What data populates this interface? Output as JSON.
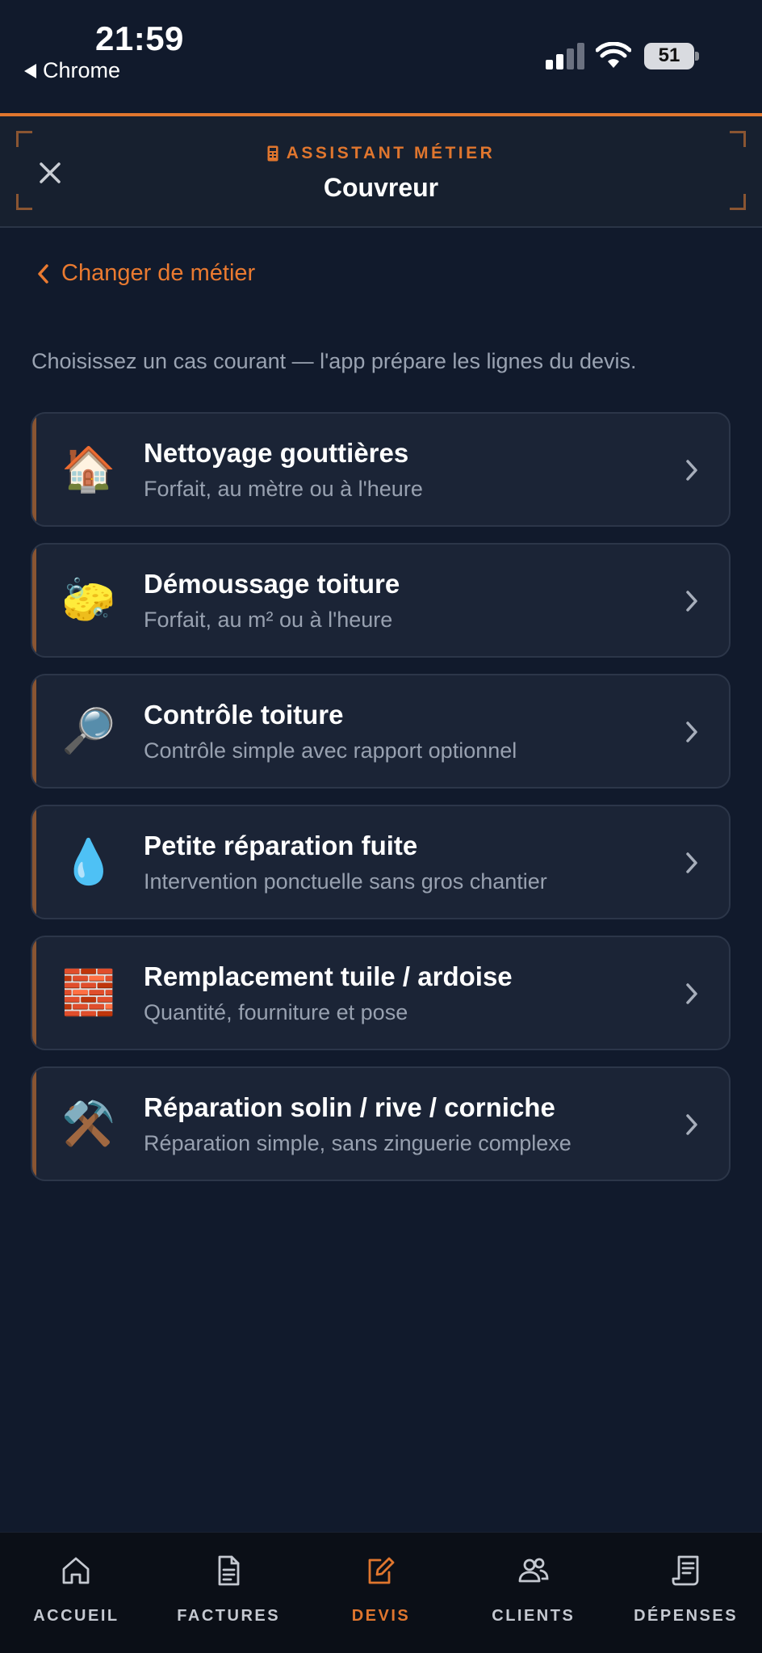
{
  "status_bar": {
    "time": "21:59",
    "back_app": "Chrome",
    "battery": "51",
    "icons": [
      "cellular-signal-icon",
      "wifi-icon",
      "battery-icon"
    ]
  },
  "header": {
    "kicker_icon": "calculator-icon",
    "kicker": "ASSISTANT MÉTIER",
    "title": "Couvreur",
    "close_icon": "close-icon"
  },
  "back_link": {
    "label": "Changer de métier",
    "icon": "chevron-left-icon"
  },
  "intro": "Choisissez un cas courant — l'app prépare les lignes du devis.",
  "cases": [
    {
      "icon": "🏠",
      "icon_name": "house-icon",
      "title": "Nettoyage gouttières",
      "subtitle": "Forfait, au mètre ou à l'heure"
    },
    {
      "icon": "🧽",
      "icon_name": "sponge-icon",
      "title": "Démoussage toiture",
      "subtitle": "Forfait, au m² ou à l'heure"
    },
    {
      "icon": "🔎",
      "icon_name": "magnifier-icon",
      "title": "Contrôle toiture",
      "subtitle": "Contrôle simple avec rapport optionnel"
    },
    {
      "icon": "💧",
      "icon_name": "droplet-icon",
      "title": "Petite réparation fuite",
      "subtitle": "Intervention ponctuelle sans gros chantier"
    },
    {
      "icon": "🧱",
      "icon_name": "brick-icon",
      "title": "Remplacement tuile / ardoise",
      "subtitle": "Quantité, fourniture et pose"
    },
    {
      "icon": "⚒️",
      "icon_name": "hammer-wrench-icon",
      "title": "Réparation solin / rive / corniche",
      "subtitle": "Réparation simple, sans zinguerie complexe"
    }
  ],
  "bottom_nav": [
    {
      "label": "ACCUEIL",
      "icon": "home-icon",
      "active": false
    },
    {
      "label": "FACTURES",
      "icon": "document-icon",
      "active": false
    },
    {
      "label": "DEVIS",
      "icon": "edit-icon",
      "active": true
    },
    {
      "label": "CLIENTS",
      "icon": "users-icon",
      "active": false
    },
    {
      "label": "DÉPENSES",
      "icon": "receipt-icon",
      "active": false
    }
  ],
  "colors": {
    "accent": "#e0762e",
    "background": "#111a2c",
    "card": "#1b2436"
  }
}
